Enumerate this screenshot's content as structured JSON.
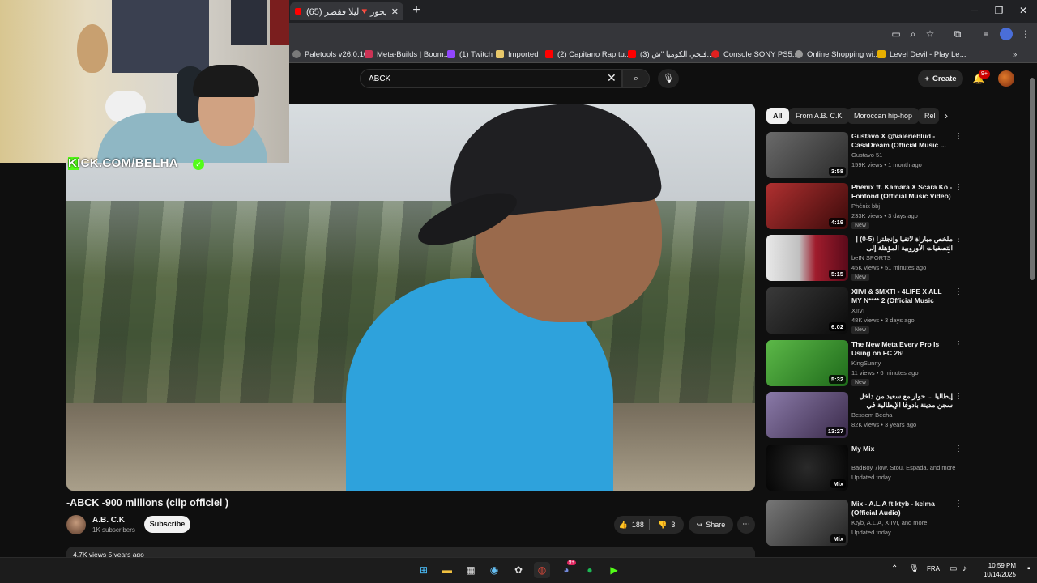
{
  "browser": {
    "tab_title": "طلقت ليحور🔻ليلا فقصر (65)",
    "bookmarks": [
      {
        "label": "Paletools v26.0.10",
        "color": "#7a7a7a"
      },
      {
        "label": "Meta-Builds | Boom...",
        "color": "#cc3355"
      },
      {
        "label": "(1) Twitch",
        "color": "#9146ff"
      },
      {
        "label": "Imported",
        "color": "#e8c86a"
      },
      {
        "label": "(2) Capitano Rap tu...",
        "color": "#ff0000"
      },
      {
        "label": "(3) فتحي الكوميا \"ش...",
        "color": "#ff0000"
      },
      {
        "label": "Console SONY PS5...",
        "color": "#e02020"
      },
      {
        "label": "Online Shopping wi...",
        "color": "#999999"
      },
      {
        "label": "Level Devil - Play Le...",
        "color": "#e8b000"
      }
    ]
  },
  "search": {
    "value": "ABCK",
    "placeholder": "Search"
  },
  "header": {
    "create_label": "Create",
    "notif_badge": "9+"
  },
  "overlay": {
    "kick_text": "KICK.COM/BELHA"
  },
  "video": {
    "title": "-ABCK -900 millions (clip officiel )",
    "channel_name": "A.B. C.K",
    "subscribers": "1K subscribers",
    "subscribe_label": "Subscribe",
    "likes": "188",
    "dislikes": "3",
    "share_label": "Share",
    "description_preview": "4.7K views  5 years ago"
  },
  "chips": [
    "All",
    "From A.B. C.K",
    "Moroccan hip-hop",
    "Rel"
  ],
  "recommendations": [
    {
      "title": "Gustavo X @Valerieblud - CasaDream (Official Music ...",
      "channel": "Gustavo 51",
      "meta": "159K views • 1 month ago",
      "duration": "3:58",
      "new": "",
      "thumb": "#4b4b4b"
    },
    {
      "title": "Phénix ft. Kamara X Scara Ko - Fonfond (Official Music Video)",
      "channel": "Phénix bbj",
      "meta": "233K views • 3 days ago",
      "duration": "4:19",
      "new": "New",
      "thumb": "#8a1e1e"
    },
    {
      "title": "ملخص مباراة لاتفيا وإنجلترا (5-0) | التصفيات الأوروبية المؤهلة إلى كأس العالم ...",
      "channel": "beIN SPORTS",
      "meta": "45K views • 51 minutes ago",
      "duration": "5:15",
      "new": "New",
      "thumb": "#6a1a2a"
    },
    {
      "title": "XIIVI & $MXTI - 4LIFE X ALL MY N**** 2 (Official Music Video)",
      "channel": "XIIVI",
      "meta": "48K views • 3 days ago",
      "duration": "6:02",
      "new": "New",
      "thumb": "#2a2a2a"
    },
    {
      "title": "The New Meta Every Pro Is Using on FC 26!",
      "channel": "KingSunny",
      "meta": "11 views • 6 minutes ago",
      "duration": "5:32",
      "new": "New",
      "thumb": "#3a8a2a"
    },
    {
      "title": "إيطاليا ... حوار مع سعيد من داخل سجن مدينة بادوفا الإيطالية في الحبس على روح و ...",
      "channel": "Bessem Becha",
      "meta": "82K views • 3 years ago",
      "duration": "13:27",
      "new": "",
      "thumb": "#5a4a6a"
    },
    {
      "title": "My Mix",
      "channel": "BadBoy 7low, Stou, Espada, and more",
      "meta": "Updated today",
      "duration": "Mix",
      "new": "",
      "thumb": "#1a1a1a"
    },
    {
      "title": "Mix - A.L.A ft ktyb - kelma (Official Audio)",
      "channel": "Ktyb, A.L.A, XIIVI, and more",
      "meta": "Updated today",
      "duration": "Mix",
      "new": "",
      "thumb": "#4a4a4a"
    }
  ],
  "taskbar": {
    "lang": "FRA",
    "time": "10:59 PM",
    "date": "10/14/2025",
    "discord_badge": "9+"
  }
}
